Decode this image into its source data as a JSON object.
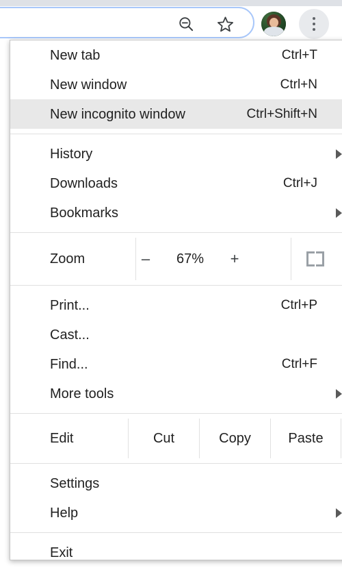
{
  "toolbar": {
    "zoom_out_icon": "zoom-out-magnifier-icon",
    "bookmark_icon": "star-outline-icon",
    "avatar": "profile-avatar",
    "menu_icon": "three-dot-menu-icon"
  },
  "menu": {
    "groups": [
      {
        "id": "new",
        "items": [
          {
            "label": "New tab",
            "accel": "Ctrl+T",
            "submenu": false,
            "highlighted": false
          },
          {
            "label": "New window",
            "accel": "Ctrl+N",
            "submenu": false,
            "highlighted": false
          },
          {
            "label": "New incognito window",
            "accel": "Ctrl+Shift+N",
            "submenu": false,
            "highlighted": true
          }
        ]
      },
      {
        "id": "browse",
        "items": [
          {
            "label": "History",
            "accel": "",
            "submenu": true,
            "highlighted": false
          },
          {
            "label": "Downloads",
            "accel": "Ctrl+J",
            "submenu": false,
            "highlighted": false
          },
          {
            "label": "Bookmarks",
            "accel": "",
            "submenu": true,
            "highlighted": false
          }
        ]
      },
      {
        "id": "page",
        "items": [
          {
            "label": "Print...",
            "accel": "Ctrl+P",
            "submenu": false,
            "highlighted": false
          },
          {
            "label": "Cast...",
            "accel": "",
            "submenu": false,
            "highlighted": false
          },
          {
            "label": "Find...",
            "accel": "Ctrl+F",
            "submenu": false,
            "highlighted": false
          },
          {
            "label": "More tools",
            "accel": "",
            "submenu": true,
            "highlighted": false
          }
        ]
      },
      {
        "id": "settings",
        "items": [
          {
            "label": "Settings",
            "accel": "",
            "submenu": false,
            "highlighted": false
          },
          {
            "label": "Help",
            "accel": "",
            "submenu": true,
            "highlighted": false
          }
        ]
      },
      {
        "id": "exit",
        "items": [
          {
            "label": "Exit",
            "accel": "",
            "submenu": false,
            "highlighted": false
          }
        ]
      }
    ],
    "zoom": {
      "label": "Zoom",
      "decrease": "–",
      "value": "67%",
      "increase": "+",
      "fullscreen_icon": "fullscreen-icon"
    },
    "edit": {
      "label": "Edit",
      "cut": "Cut",
      "copy": "Copy",
      "paste": "Paste"
    }
  },
  "colors": {
    "highlight": "#e8e8e8",
    "omnibox_border": "#a8c7fa",
    "separator": "#e0e0e0",
    "text": "#212121",
    "menu_button_bg": "#e8eaed"
  }
}
